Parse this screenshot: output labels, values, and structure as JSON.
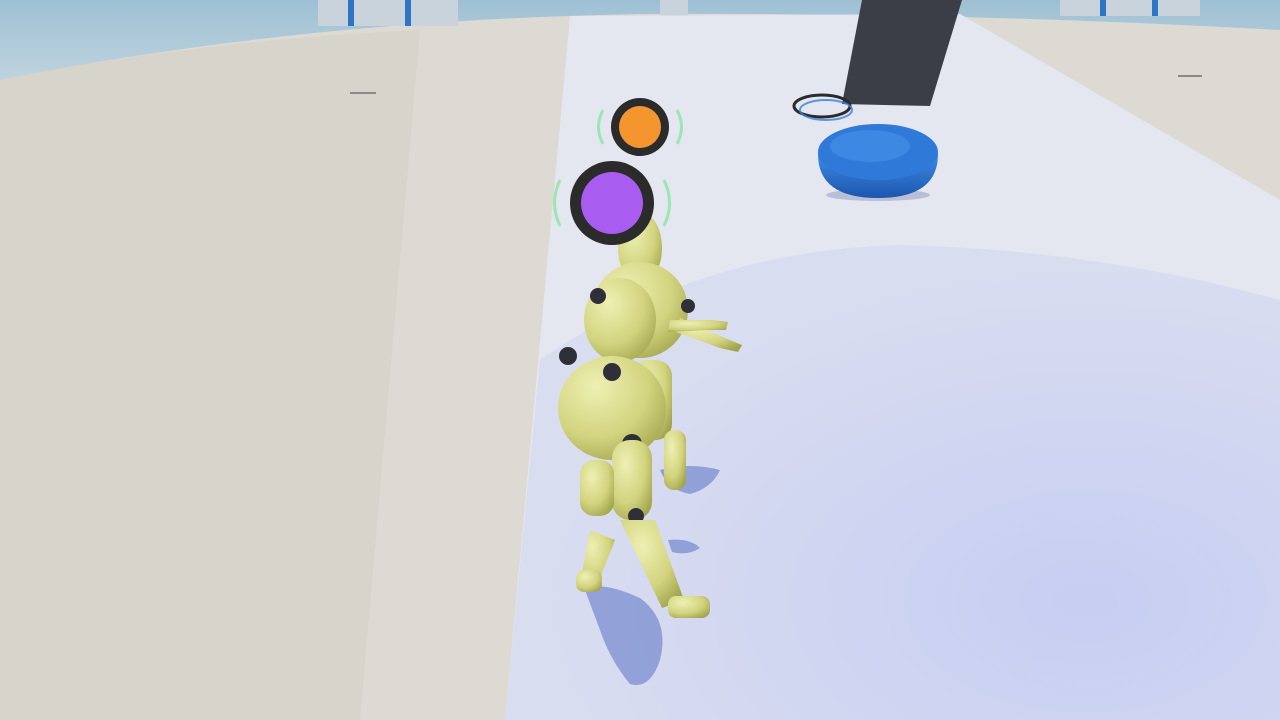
{
  "scene": {
    "description_free": true,
    "colors": {
      "sky": "#9fc3d6",
      "wall": "#b8d2de",
      "floor": "#dcdad3",
      "floor_shadow": "#cfccc3",
      "mat": "#e6e8f2",
      "mat_light": "#c5cdf2",
      "pillar": "#c9d4dc",
      "pillar_stripe": "#2f74c6",
      "mannequin": "#d8d98a",
      "mannequin_shade": "#a9aa55",
      "joint": "#2f2f3a",
      "dome": "#2f7ad8",
      "dome_dark": "#1f5ab0",
      "panel": "#3a3d46",
      "ring": "#3b82d8",
      "shadow": "#5a73c4"
    }
  },
  "players": [
    {
      "id": "orange",
      "color": "#f4952e",
      "ring": "#2b2b2b"
    },
    {
      "id": "purple",
      "color": "#a85cf0",
      "ring": "#2b2b2b"
    }
  ]
}
